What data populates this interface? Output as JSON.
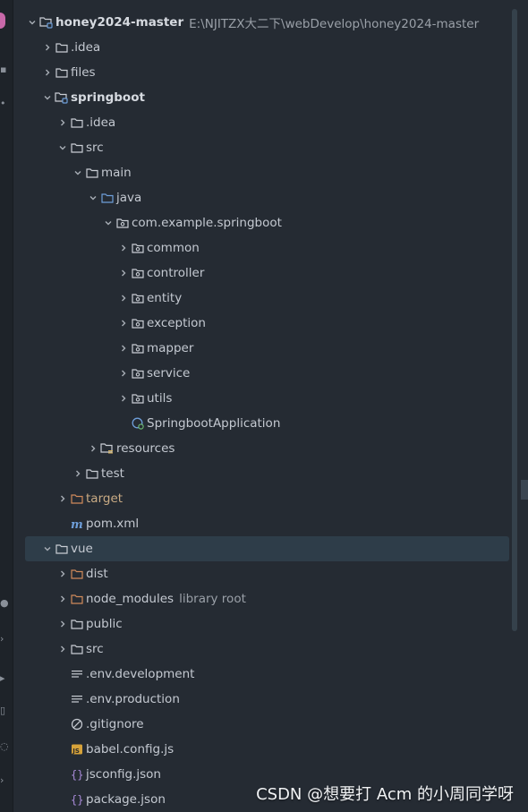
{
  "project": {
    "name": "honey2024-master",
    "path": "E:\\NJITZX大二下\\webDevelop\\honey2024-master"
  },
  "tree": [
    {
      "label": "honey2024-master",
      "hint": "E:\\NJITZX大二下\\webDevelop\\honey2024-master",
      "depth": 0,
      "expand": "open",
      "icon": "module-folder",
      "bold": true,
      "color": "normal"
    },
    {
      "label": ".idea",
      "depth": 1,
      "expand": "closed",
      "icon": "folder"
    },
    {
      "label": "files",
      "depth": 1,
      "expand": "closed",
      "icon": "folder"
    },
    {
      "label": "springboot",
      "depth": 1,
      "expand": "open",
      "icon": "module-folder",
      "bold": true
    },
    {
      "label": ".idea",
      "depth": 2,
      "expand": "closed",
      "icon": "folder"
    },
    {
      "label": "src",
      "depth": 2,
      "expand": "open",
      "icon": "folder"
    },
    {
      "label": "main",
      "depth": 3,
      "expand": "open",
      "icon": "folder"
    },
    {
      "label": "java",
      "depth": 4,
      "expand": "open",
      "icon": "source-folder"
    },
    {
      "label": "com.example.springboot",
      "depth": 5,
      "expand": "open",
      "icon": "package"
    },
    {
      "label": "common",
      "depth": 6,
      "expand": "closed",
      "icon": "package"
    },
    {
      "label": "controller",
      "depth": 6,
      "expand": "closed",
      "icon": "package"
    },
    {
      "label": "entity",
      "depth": 6,
      "expand": "closed",
      "icon": "package"
    },
    {
      "label": "exception",
      "depth": 6,
      "expand": "closed",
      "icon": "package"
    },
    {
      "label": "mapper",
      "depth": 6,
      "expand": "closed",
      "icon": "package"
    },
    {
      "label": "service",
      "depth": 6,
      "expand": "closed",
      "icon": "package"
    },
    {
      "label": "utils",
      "depth": 6,
      "expand": "closed",
      "icon": "package"
    },
    {
      "label": "SpringbootApplication",
      "depth": 6,
      "expand": "none",
      "icon": "spring-class"
    },
    {
      "label": "resources",
      "depth": 4,
      "expand": "closed",
      "icon": "resources-folder"
    },
    {
      "label": "test",
      "depth": 3,
      "expand": "closed",
      "icon": "folder"
    },
    {
      "label": "target",
      "depth": 2,
      "expand": "closed",
      "icon": "excluded-folder",
      "color": "orange"
    },
    {
      "label": "pom.xml",
      "depth": 2,
      "expand": "none",
      "icon": "maven"
    },
    {
      "label": "vue",
      "depth": 1,
      "expand": "open",
      "icon": "folder",
      "selected": true
    },
    {
      "label": "dist",
      "depth": 2,
      "expand": "closed",
      "icon": "excluded-folder"
    },
    {
      "label": "node_modules",
      "hint": "library root",
      "depth": 2,
      "expand": "closed",
      "icon": "excluded-folder"
    },
    {
      "label": "public",
      "depth": 2,
      "expand": "closed",
      "icon": "folder"
    },
    {
      "label": "src",
      "depth": 2,
      "expand": "closed",
      "icon": "folder"
    },
    {
      "label": ".env.development",
      "depth": 2,
      "expand": "none",
      "icon": "text-file"
    },
    {
      "label": ".env.production",
      "depth": 2,
      "expand": "none",
      "icon": "text-file"
    },
    {
      "label": ".gitignore",
      "depth": 2,
      "expand": "none",
      "icon": "ignore-file"
    },
    {
      "label": "babel.config.js",
      "depth": 2,
      "expand": "none",
      "icon": "js-file"
    },
    {
      "label": "jsconfig.json",
      "depth": 2,
      "expand": "none",
      "icon": "json-file"
    },
    {
      "label": "package.json",
      "depth": 2,
      "expand": "none",
      "icon": "json-file"
    }
  ],
  "watermark": "CSDN @想要打 Acm 的小周同学呀",
  "colors": {
    "background": "#252b33",
    "selection": "#2e3d49",
    "folder_outline": "#c9cdd4",
    "source_folder": "#6e9ed9",
    "excluded_folder": "#d08a5b",
    "text": "#c4c9d1"
  }
}
